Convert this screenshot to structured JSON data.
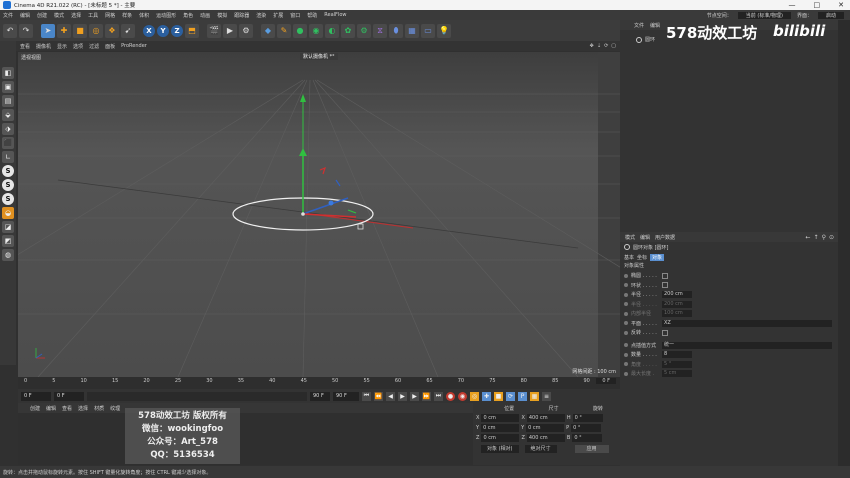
{
  "window": {
    "title": "Cinema 4D R21.022 (RC) - [未标题 5 *] - 主要",
    "controls": [
      "—",
      "□",
      "✕"
    ]
  },
  "menubar": {
    "items": [
      "文件",
      "编辑",
      "创建",
      "模式",
      "选择",
      "工具",
      "网格",
      "样条",
      "体积",
      "运动图形",
      "角色",
      "动画",
      "模拟",
      "跟踪器",
      "渲染",
      "扩展",
      "窗口",
      "帮助",
      "RealFlow"
    ],
    "layout_label": "节点空间：",
    "layout_value": "当前 (标准/物理)",
    "interface_label": "界面：",
    "interface_value": "启动"
  },
  "viewport": {
    "menu": [
      "查看",
      "摄像机",
      "显示",
      "选项",
      "过滤",
      "面板",
      "ProRender"
    ],
    "label": "透视视图",
    "camera": "默认摄像机 *°",
    "grid_spacing": "网格间距 : 100 cm"
  },
  "timeline": {
    "ticks": [
      "0",
      "5",
      "10",
      "15",
      "20",
      "25",
      "30",
      "35",
      "40",
      "45",
      "50",
      "55",
      "60",
      "65",
      "70",
      "75",
      "80",
      "85",
      "90"
    ],
    "current_frame": "0 F"
  },
  "playbar": {
    "start": "0 F",
    "start2": "0 F",
    "end": "90 F",
    "end2": "90 F"
  },
  "materials": {
    "menu": [
      "创建",
      "编辑",
      "查看",
      "选择",
      "材质",
      "纹理"
    ]
  },
  "watermark": {
    "line1": "578动效工坊 版权所有",
    "line2": "微信：wookingfoo",
    "line3": "公众号：Art_578",
    "line4": "QQ：5136534"
  },
  "coords": {
    "headers": [
      "位置",
      "尺寸",
      "旋转"
    ],
    "rows": [
      {
        "axis": "X",
        "pos": "0 cm",
        "size_axis": "X",
        "size": "400 cm",
        "rot_axis": "H",
        "rot": "0 °"
      },
      {
        "axis": "Y",
        "pos": "0 cm",
        "size_axis": "Y",
        "size": "0 cm",
        "rot_axis": "P",
        "rot": "0 °"
      },
      {
        "axis": "Z",
        "pos": "0 cm",
        "size_axis": "Z",
        "size": "400 cm",
        "rot_axis": "B",
        "rot": "0 °"
      }
    ],
    "mode": "对象 (相对)",
    "size_mode": "绝对尺寸",
    "apply": "应用"
  },
  "status": {
    "text": "旋转：点击并拖动鼠标旋转元素。按住 SHIFT 键量化旋转角度；按住 CTRL 键减少选择对象。"
  },
  "objects": {
    "menu": [
      "文件",
      "编辑"
    ],
    "item": "圆环"
  },
  "brand": {
    "text": "578动效工坊",
    "logo": "bilibili"
  },
  "attributes": {
    "menu": [
      "模式",
      "编辑",
      "用户数据"
    ],
    "object": "圆环对象 [圆环]",
    "tabs": [
      "基本",
      "坐标",
      "对象"
    ],
    "section": "对象属性",
    "rows": [
      {
        "label": "椭圆 . . . . .",
        "type": "check",
        "value": ""
      },
      {
        "label": "环状 . . . . .",
        "type": "check",
        "value": ""
      },
      {
        "label": "半径 . . . . .",
        "type": "value",
        "value": "200 cm"
      },
      {
        "label": "半径 . . . . .",
        "type": "value",
        "value": "200 cm",
        "dim": true
      },
      {
        "label": "内部半径",
        "type": "value",
        "value": "100 cm",
        "dim": true
      },
      {
        "label": "平面 . . . . .",
        "type": "wide",
        "value": "XZ"
      },
      {
        "label": "反转 . . . . .",
        "type": "check",
        "value": ""
      },
      {
        "label": "点插值方式",
        "type": "wide",
        "value": "统一"
      },
      {
        "label": "数量 . . . . .",
        "type": "value",
        "value": "8"
      },
      {
        "label": "角度 . . . . .",
        "type": "value",
        "value": "5 °",
        "dim": true
      },
      {
        "label": "最大长度 .",
        "type": "value",
        "value": "5 cm",
        "dim": true
      }
    ]
  }
}
